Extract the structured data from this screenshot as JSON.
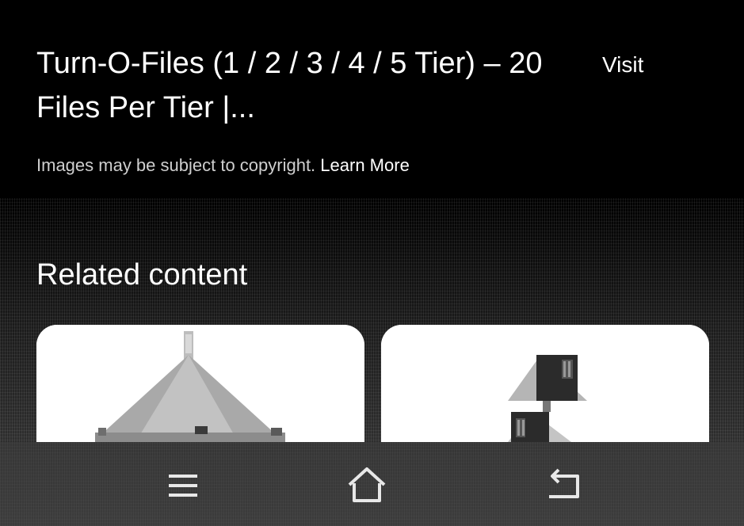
{
  "result": {
    "title": "Turn-O-Files (1 / 2 / 3 / 4 / 5 Tier) – 20 Files Per Tier |...",
    "visit_label": "Visit",
    "copyright_text": "Images may be subject to copyright.",
    "learn_more_label": "Learn More"
  },
  "related": {
    "heading": "Related content",
    "cards": [
      {
        "icon": "pyramid-shelf-thumbnail"
      },
      {
        "icon": "file-rack-thumbnail"
      }
    ]
  },
  "navbar": {
    "buttons": [
      {
        "icon": "menu-icon"
      },
      {
        "icon": "home-icon"
      },
      {
        "icon": "back-icon"
      }
    ]
  }
}
